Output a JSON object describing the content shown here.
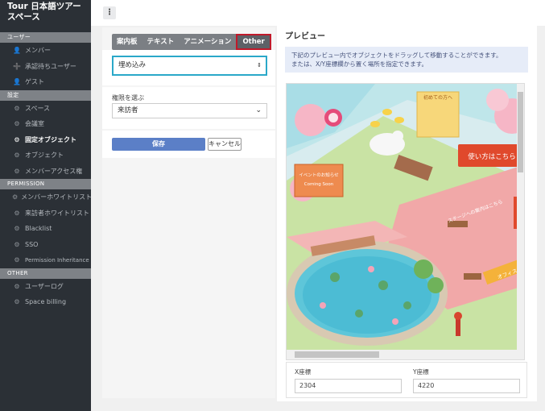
{
  "sidebar": {
    "brand": "Tour 日本語ツアースペース",
    "sections": [
      {
        "header": "ユーザー",
        "items": [
          {
            "label": "メンバー",
            "icon": "person-icon"
          },
          {
            "label": "承認待ちユーザー",
            "icon": "person-add-icon"
          },
          {
            "label": "ゲスト",
            "icon": "person-icon"
          }
        ]
      },
      {
        "header": "設定",
        "items": [
          {
            "label": "スペース",
            "icon": "gear-icon"
          },
          {
            "label": "会議室",
            "icon": "gear-icon"
          },
          {
            "label": "固定オブジェクト",
            "icon": "gear-icon",
            "active": true
          },
          {
            "label": "オブジェクト",
            "icon": "gear-icon"
          },
          {
            "label": "メンバーアクセス権",
            "icon": "gear-icon"
          }
        ]
      },
      {
        "header": "PERMISSION",
        "items": [
          {
            "label": "メンバーホワイトリスト",
            "icon": "gear-icon"
          },
          {
            "label": "来訪者ホワイトリスト",
            "icon": "gear-icon"
          },
          {
            "label": "Blacklist",
            "icon": "gear-icon"
          },
          {
            "label": "SSO",
            "icon": "gear-icon"
          },
          {
            "label": "Permission Inheritance",
            "icon": "gear-icon"
          }
        ]
      },
      {
        "header": "OTHER",
        "items": [
          {
            "label": "ユーザーログ",
            "icon": "gear-icon"
          },
          {
            "label": "Space billing",
            "icon": "gear-icon"
          }
        ]
      }
    ]
  },
  "topbar": {
    "menu_icon": "⋮"
  },
  "form": {
    "tabs": [
      "案内板",
      "テキスト",
      "アニメーション",
      "Other"
    ],
    "active_tab": "Other",
    "type_select": {
      "value": "埋め込み",
      "arrow": "⇕"
    },
    "permission_label": "権限を選ぶ",
    "permission_select": {
      "value": "来訪者",
      "arrow": "⌄"
    },
    "save_label": "保存",
    "cancel_label": "キャンセル"
  },
  "preview": {
    "title": "プレビュー",
    "info_line1": "下記のプレビュー内でオブジェクトをドラッグして移動することができます。",
    "info_line2": "または、X/Y座標欄から置く場所を指定できます。",
    "sign_first": "初めての方へ",
    "sign_howto": "使い方はこちら",
    "sign_event1": "イベントのお知らせ",
    "sign_event2": "Coming Soon",
    "sign_stage": "ステージへの案内はこちら",
    "sign_office": "オフィス"
  },
  "coords": {
    "x_label": "X座標",
    "x_value": "2304",
    "y_label": "Y座標",
    "y_value": "4220"
  },
  "colors": {
    "sidebar_bg": "#2b3036",
    "section_header": "#7e8287",
    "save_button": "#5b7fc7",
    "highlight_border": "#2aa8c9",
    "other_tab_border": "#c0192a"
  }
}
